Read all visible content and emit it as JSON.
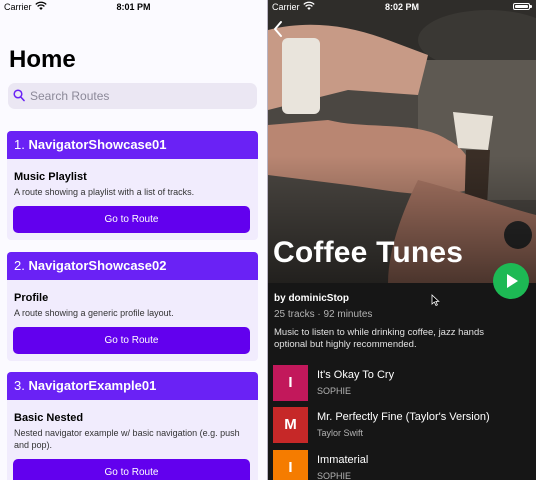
{
  "left": {
    "status": {
      "carrier": "Carrier",
      "time": "8:01 PM"
    },
    "title": "Home",
    "search": {
      "placeholder": "Search Routes"
    },
    "cards": [
      {
        "num": "1.",
        "name": "NavigatorShowcase01",
        "title": "Music Playlist",
        "desc": "A route showing a playlist with a list of tracks.",
        "button": "Go to Route"
      },
      {
        "num": "2.",
        "name": "NavigatorShowcase02",
        "title": "Profile",
        "desc": "A route showing a generic profile layout.",
        "button": "Go to Route"
      },
      {
        "num": "3.",
        "name": "NavigatorExample01",
        "title": "Basic Nested",
        "desc": "Nested navigator example w/ basic navigation (e.g. push and pop).",
        "button": "Go to Route"
      }
    ],
    "colors": {
      "accent": "#6200ee",
      "card_head": "#6a22f5",
      "card_bg": "#f1ecfd"
    }
  },
  "right": {
    "status": {
      "carrier": "Carrier",
      "time": "8:02 PM"
    },
    "title": "Coffee Tunes",
    "by": "by dominicStop",
    "meta": "25 tracks · 92 minutes",
    "description": "Music to listen to while drinking coffee, jazz hands optional but highly recommended.",
    "tracks": [
      {
        "initial": "I",
        "title": "It's Okay To Cry",
        "artist": "SOPHIE",
        "color": "#c2185b"
      },
      {
        "initial": "M",
        "title": "Mr. Perfectly Fine (Taylor's Version)",
        "artist": "Taylor Swift",
        "color": "#c62828"
      },
      {
        "initial": "I",
        "title": "Immaterial",
        "artist": "SOPHIE",
        "color": "#f57c00"
      }
    ],
    "colors": {
      "play": "#1db954",
      "bg": "#161616"
    }
  }
}
